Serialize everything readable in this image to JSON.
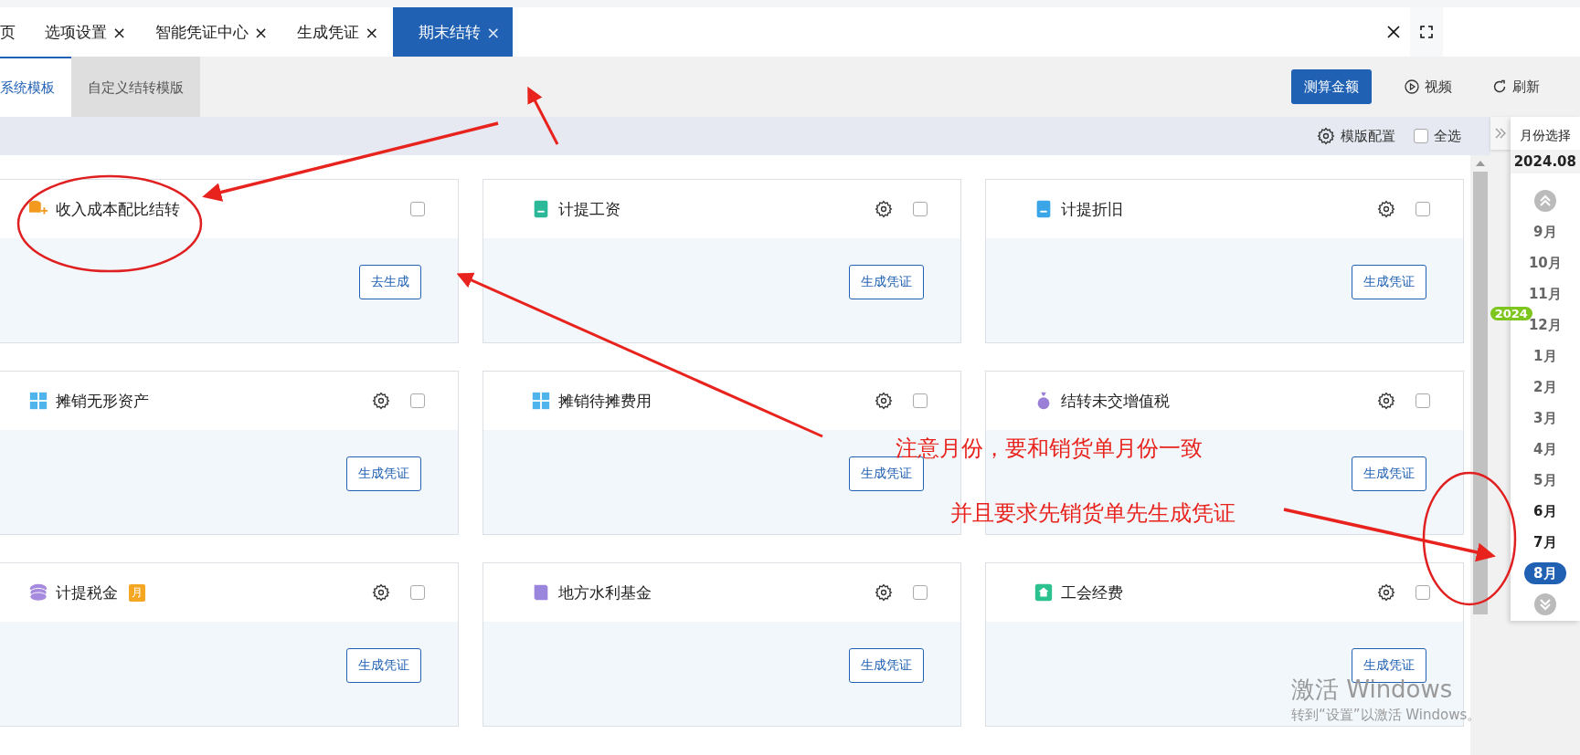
{
  "tabs": [
    {
      "label": "页",
      "selected": false
    },
    {
      "label": "选项设置",
      "selected": false,
      "close": "×"
    },
    {
      "label": "智能凭证中心",
      "selected": false,
      "close": "×"
    },
    {
      "label": "生成凭证",
      "selected": false,
      "close": "×"
    },
    {
      "label": "期末结转",
      "selected": true,
      "close": "×"
    }
  ],
  "toolbar": {
    "template_tabs": [
      {
        "label": "系统模板",
        "selected": true
      },
      {
        "label": "自定义结转模版",
        "selected": false
      }
    ],
    "buttons": [
      {
        "label": "测算金额",
        "kind": "primary"
      },
      {
        "label": "视频",
        "kind": "video"
      },
      {
        "label": "刷新",
        "kind": "refresh"
      }
    ]
  },
  "options_bar": {
    "config_label": "模版配置",
    "select_all": {
      "label": "全选",
      "checked": false
    }
  },
  "cards": [
    {
      "title": "收入成本配比结转",
      "kind": "coins",
      "color": "#f39a1e",
      "settings": false,
      "checked": false,
      "button": "去生成"
    },
    {
      "title": "计提工资",
      "kind": "document",
      "color": "#2cb99a",
      "settings": true,
      "checked": false,
      "button": "生成凭证"
    },
    {
      "title": "计提折旧",
      "kind": "document",
      "color": "#3aa6e8",
      "settings": true,
      "checked": false,
      "button": "生成凭证"
    },
    {
      "title": "摊销无形资产",
      "kind": "grid",
      "color": "#4fb3ec",
      "settings": true,
      "checked": false,
      "button": "生成凭证"
    },
    {
      "title": "摊销待摊费用",
      "kind": "grid",
      "color": "#4fb3ec",
      "settings": true,
      "checked": false,
      "button": "生成凭证"
    },
    {
      "title": "结转未交增值税",
      "kind": "bag",
      "color": "#9b7fd6",
      "settings": true,
      "checked": false,
      "button": "生成凭证"
    },
    {
      "title": "计提税金",
      "kind": "stack",
      "color": "#a58ade",
      "settings": true,
      "checked": false,
      "button": "生成凭证",
      "badge": "月"
    },
    {
      "title": "地方水利基金",
      "kind": "book",
      "color": "#9a86dc",
      "settings": true,
      "checked": false,
      "button": "生成凭证"
    },
    {
      "title": "工会经费",
      "kind": "home",
      "color": "#2cc290",
      "settings": true,
      "checked": false,
      "button": "生成凭证"
    }
  ],
  "month_panel": {
    "title": "月份选择",
    "value": "2024.08",
    "year_badge": "2024",
    "previous_year_months": [
      {
        "label": "9月",
        "selected": false,
        "highlighted": false
      },
      {
        "label": "10月",
        "selected": false,
        "highlighted": false
      },
      {
        "label": "11月",
        "selected": false,
        "highlighted": false
      },
      {
        "label": "12月",
        "selected": false,
        "highlighted": false
      }
    ],
    "months": [
      {
        "label": "1月",
        "selected": false,
        "highlighted": false
      },
      {
        "label": "2月",
        "selected": false,
        "highlighted": false
      },
      {
        "label": "3月",
        "selected": false,
        "highlighted": false
      },
      {
        "label": "4月",
        "selected": false,
        "highlighted": false
      },
      {
        "label": "5月",
        "selected": false,
        "highlighted": false
      },
      {
        "label": "6月",
        "selected": false,
        "highlighted": true
      },
      {
        "label": "7月",
        "selected": false,
        "highlighted": true
      },
      {
        "label": "8月",
        "selected": true,
        "highlighted": false
      }
    ]
  },
  "annotations": {
    "notes": [
      "注意月份，要和销货单月份一致",
      "并且要求先销货单先生成凭证"
    ]
  },
  "os_notice": {
    "title": "激活 Windows",
    "text": "转到“设置”以激活 Windows。"
  }
}
